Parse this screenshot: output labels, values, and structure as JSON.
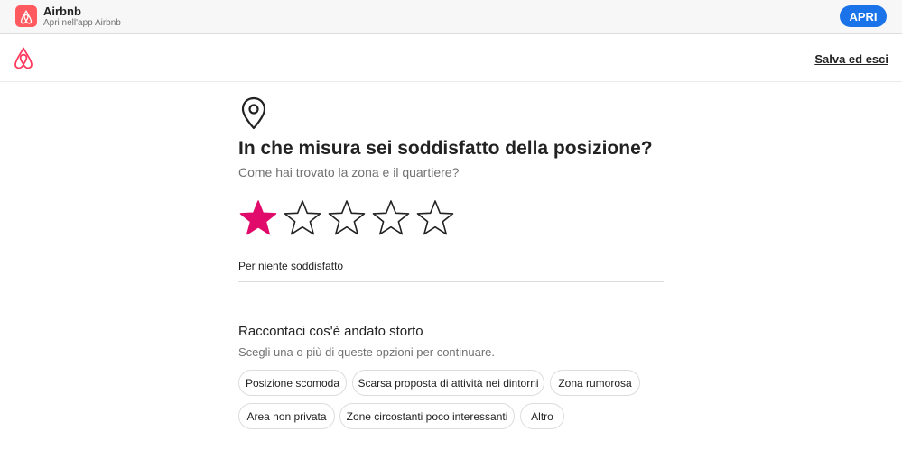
{
  "app_banner": {
    "name": "Airbnb",
    "subtitle": "Apri nell'app Airbnb",
    "open_label": "APRI"
  },
  "header": {
    "save_exit_label": "Salva ed esci"
  },
  "question": {
    "title": "In che misura sei soddisfatto della posizione?",
    "subtitle": "Come hai trovato la zona e il quartiere?",
    "rating": 1,
    "max_rating": 5,
    "rating_label": "Per niente soddisfatto"
  },
  "feedback": {
    "title": "Raccontaci cos'è andato storto",
    "subtitle": "Scegli una o più di queste opzioni per continuare.",
    "options": [
      "Posizione scomoda",
      "Scarsa proposta di attività nei dintorni",
      "Zona rumorosa",
      "Area non privata",
      "Zone circostanti poco interessanti",
      "Altro"
    ]
  },
  "colors": {
    "brand": "#ff385c",
    "star_filled": "#e00b6a",
    "open_button": "#1a73e8"
  }
}
